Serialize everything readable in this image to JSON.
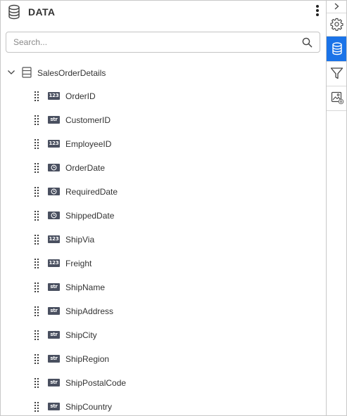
{
  "panel": {
    "title": "DATA",
    "icon": "database-icon",
    "menu_icon": "more-vertical-icon"
  },
  "search": {
    "placeholder": "Search...",
    "value": "",
    "icon": "search-icon"
  },
  "tree": {
    "root": {
      "label": "SalesOrderDetails",
      "expanded": true,
      "icon": "table-icon"
    },
    "fields": [
      {
        "label": "OrderID",
        "type": "123"
      },
      {
        "label": "CustomerID",
        "type": "str"
      },
      {
        "label": "EmployeeID",
        "type": "123"
      },
      {
        "label": "OrderDate",
        "type": "date"
      },
      {
        "label": "RequiredDate",
        "type": "date"
      },
      {
        "label": "ShippedDate",
        "type": "date"
      },
      {
        "label": "ShipVia",
        "type": "123"
      },
      {
        "label": "Freight",
        "type": "123"
      },
      {
        "label": "ShipName",
        "type": "str"
      },
      {
        "label": "ShipAddress",
        "type": "str"
      },
      {
        "label": "ShipCity",
        "type": "str"
      },
      {
        "label": "ShipRegion",
        "type": "str"
      },
      {
        "label": "ShipPostalCode",
        "type": "str"
      },
      {
        "label": "ShipCountry",
        "type": "str"
      }
    ]
  },
  "toolbar": {
    "items": [
      {
        "icon": "chevron-right-icon",
        "active": false
      },
      {
        "icon": "gear-icon",
        "active": false
      },
      {
        "icon": "database-icon",
        "active": true
      },
      {
        "icon": "filter-icon",
        "active": false
      },
      {
        "icon": "image-settings-icon",
        "active": false
      }
    ]
  },
  "colors": {
    "accent": "#1a73e8",
    "badge": "#4a5060",
    "border": "#c8c8c8",
    "text": "#333333"
  }
}
